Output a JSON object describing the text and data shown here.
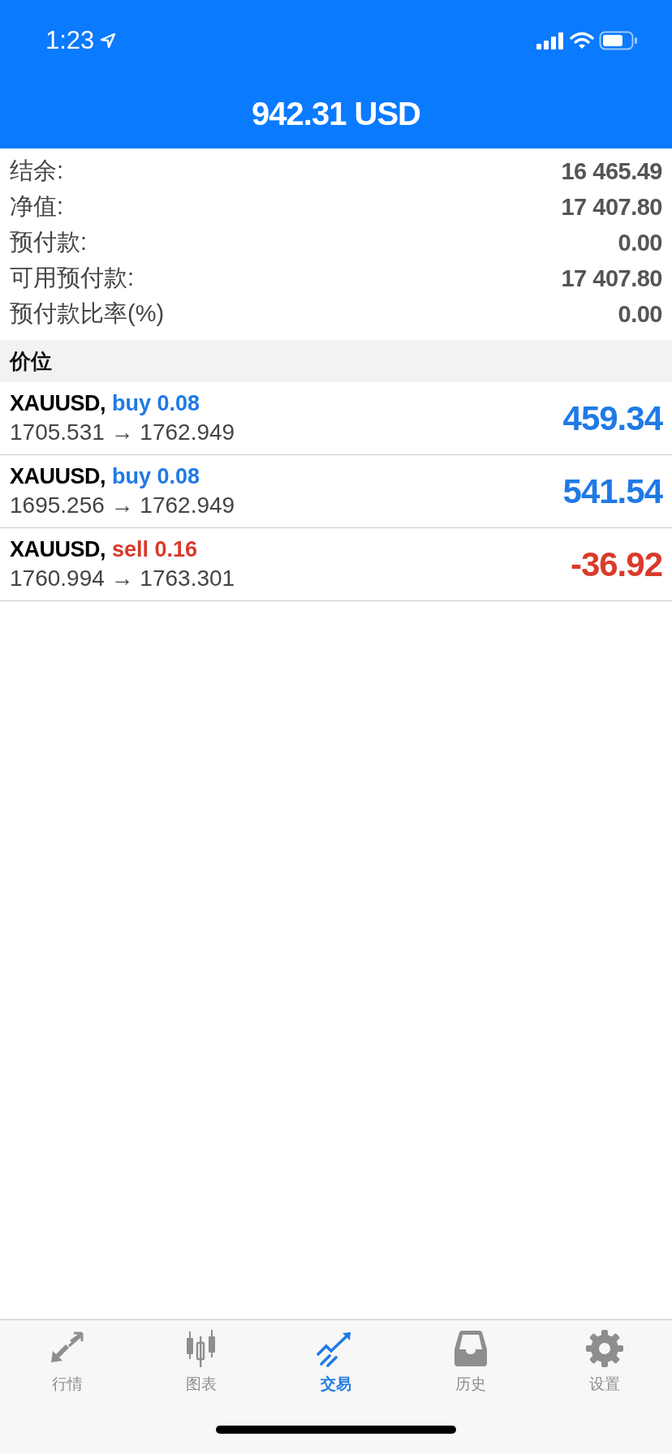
{
  "status_bar": {
    "time": "1:23"
  },
  "header": {
    "title": "942.31 USD"
  },
  "summary": [
    {
      "label": "结余:",
      "value": "16 465.49"
    },
    {
      "label": "净值:",
      "value": "17 407.80"
    },
    {
      "label": "预付款:",
      "value": "0.00"
    },
    {
      "label": "可用预付款:",
      "value": "17 407.80"
    },
    {
      "label": "预付款比率(%)",
      "value": "0.00"
    }
  ],
  "section_title": "价位",
  "positions": [
    {
      "symbol": "XAUUSD,",
      "kind": "buy",
      "order": "buy 0.08",
      "prices": "1705.531 → 1762.949",
      "profit": "459.34"
    },
    {
      "symbol": "XAUUSD,",
      "kind": "buy",
      "order": "buy 0.08",
      "prices": "1695.256 → 1762.949",
      "profit": "541.54"
    },
    {
      "symbol": "XAUUSD,",
      "kind": "sell",
      "order": "sell 0.16",
      "prices": "1760.994 → 1763.301",
      "profit": "-36.92"
    }
  ],
  "tabs": [
    {
      "kind": "quotes",
      "label": "行情",
      "selected": false
    },
    {
      "kind": "chart",
      "label": "图表",
      "selected": false
    },
    {
      "kind": "trade",
      "label": "交易",
      "selected": true
    },
    {
      "kind": "history",
      "label": "历史",
      "selected": false
    },
    {
      "kind": "settings",
      "label": "设置",
      "selected": false
    }
  ]
}
